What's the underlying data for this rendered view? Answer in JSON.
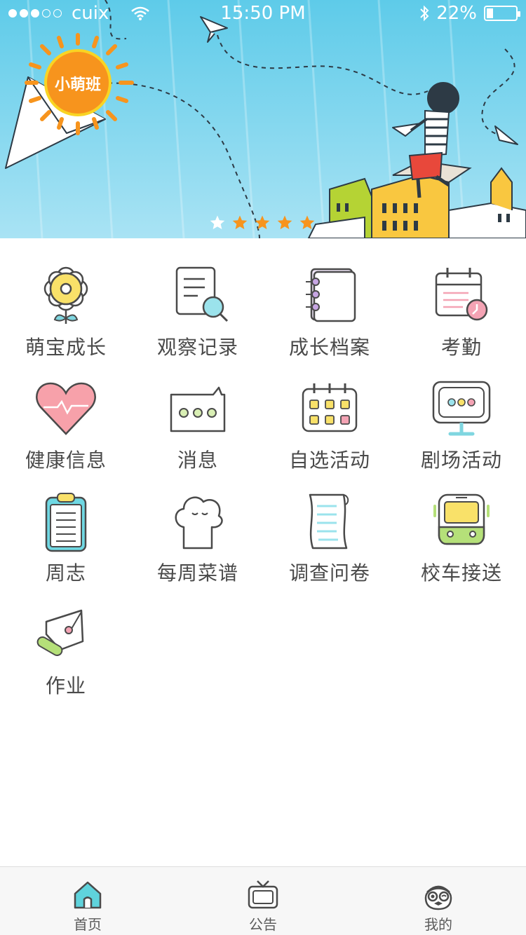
{
  "status_bar": {
    "carrier": "cuix",
    "time": "15:50 PM",
    "battery": "22%",
    "battery_level": 0.22,
    "signal_bars": 3
  },
  "banner": {
    "badge": "小萌班",
    "pager": {
      "total": 5,
      "active": 0
    },
    "colors": {
      "sky": "#7dd3ee",
      "sun": "#f7941d",
      "star_active": "#ffffff",
      "star_inactive": "#f7941d"
    }
  },
  "grid": {
    "items": [
      {
        "label": "萌宝成长",
        "icon": "flower-icon"
      },
      {
        "label": "观察记录",
        "icon": "document-search-icon"
      },
      {
        "label": "成长档案",
        "icon": "notebook-icon"
      },
      {
        "label": "考勤",
        "icon": "calendar-clock-icon"
      },
      {
        "label": "健康信息",
        "icon": "heart-pulse-icon"
      },
      {
        "label": "消息",
        "icon": "message-icon"
      },
      {
        "label": "自选活动",
        "icon": "calendar-grid-icon"
      },
      {
        "label": "剧场活动",
        "icon": "monitor-icon"
      },
      {
        "label": "周志",
        "icon": "clipboard-icon"
      },
      {
        "label": "每周菜谱",
        "icon": "chef-hat-icon"
      },
      {
        "label": "调查问卷",
        "icon": "scroll-icon"
      },
      {
        "label": "校车接送",
        "icon": "bus-icon"
      },
      {
        "label": "作业",
        "icon": "pen-nib-icon"
      }
    ]
  },
  "tabbar": {
    "tabs": [
      {
        "label": "首页",
        "icon": "home-icon",
        "active": true
      },
      {
        "label": "公告",
        "icon": "tv-icon",
        "active": false
      },
      {
        "label": "我的",
        "icon": "profile-face-icon",
        "active": false
      }
    ],
    "accent": "#5fd3dc"
  }
}
